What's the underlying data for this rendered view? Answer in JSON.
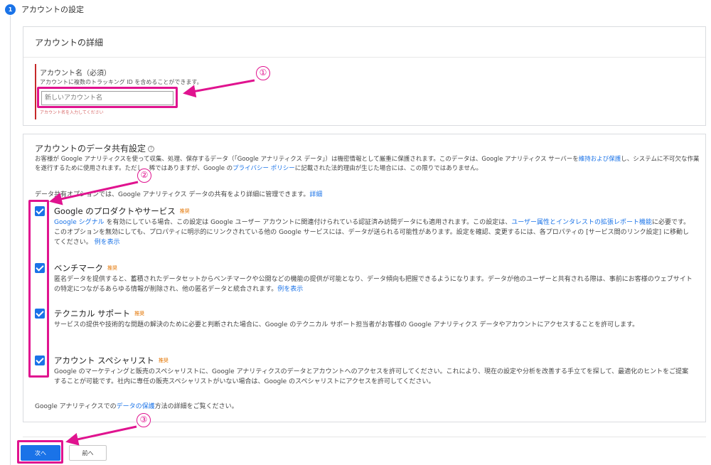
{
  "step": {
    "number": "1",
    "title": "アカウントの設定"
  },
  "account_details": {
    "heading": "アカウントの詳細",
    "field_label": "アカウント名（必須）",
    "field_help": "アカウントに複数のトラッキング ID を含めることができます。",
    "input_value": "",
    "input_placeholder": "新しいアカウント名",
    "error_text": "アカウント名を入力してください"
  },
  "sharing": {
    "heading": "アカウントのデータ共有設定",
    "desc1": "お客様が Google アナリティクスを使って収集、処理、保存するデータ（「Google アナリティクス データ」）は機密情報として厳重に保護されます。このデータは、Google アナリティクス サーバーを",
    "desc_link1": "維持および保護",
    "desc2": "し、システムに不可欠な作業を遂行するために使用されます。ただし、稀ではありますが、Google の",
    "desc_link2": "プライバシー ポリシー",
    "desc3": "に記載された法的理由が生じた場合には、この限りではありません。",
    "options_intro": "データ共有オプションでは、Google アナリティクス データの共有をより詳細に管理できます。",
    "options_link": "詳細",
    "options": [
      {
        "title": "Google のプロダクトやサービス",
        "badge": "推奨",
        "link_pre": "Google シグナル",
        "body": "を有効にしている場合、この設定は Google ユーザー アカウントに関連付けられている認証済み訪問データにも適用されます。この設定は、",
        "link_mid": "ユーザー属性とインタレストの拡張レポート機能",
        "body2": "に必要です。このオプションを無効にしても、プロパティに明示的にリンクされている他の Google サービスには、データが送られる可能性があります。設定を確認、変更するには、各プロパティの [サービス間のリンク設定] に移動してください。",
        "link_end": "例を表示"
      },
      {
        "title": "ベンチマーク",
        "badge": "推奨",
        "body": "匿名データを提供すると、蓄積されたデータセットからベンチマークや公開などの機能の提供が可能となり、データ傾向も把握できるようになります。データが他のユーザーと共有される際は、事前にお客様のウェブサイトの特定につながるあらゆる情報が削除され、他の匿名データと統合されます。",
        "link_end": "例を表示"
      },
      {
        "title": "テクニカル サポート",
        "badge": "推奨",
        "body": "サービスの提供や技術的な問題の解決のために必要と判断された場合に、Google のテクニカル サポート担当者がお客様の Google アナリティクス データやアカウントにアクセスすることを許可します。"
      },
      {
        "title": "アカウント スペシャリスト",
        "badge": "推奨",
        "body": "Google のマーケティングと販売のスペシャリストに、Google アナリティクスのデータとアカウントへのアクセスを許可してください。これにより、現在の設定や分析を改善する手立てを探して、最適化のヒントをご提案することが可能です。社内に専任の販売スペシャリストがいない場合は、Google のスペシャリストにアクセスを許可してください。"
      }
    ],
    "footer_pre": "Google アナリティクスでの",
    "footer_link": "データの保護",
    "footer_post": "方法の詳細をご覧ください。"
  },
  "buttons": {
    "next": "次へ",
    "prev": "前へ"
  },
  "annotations": {
    "m1": "①",
    "m2": "②",
    "m3": "③",
    "color": "#e0138f"
  },
  "colors": {
    "primary": "#1a73e8",
    "error": "#c62828",
    "badge": "#e37400"
  }
}
